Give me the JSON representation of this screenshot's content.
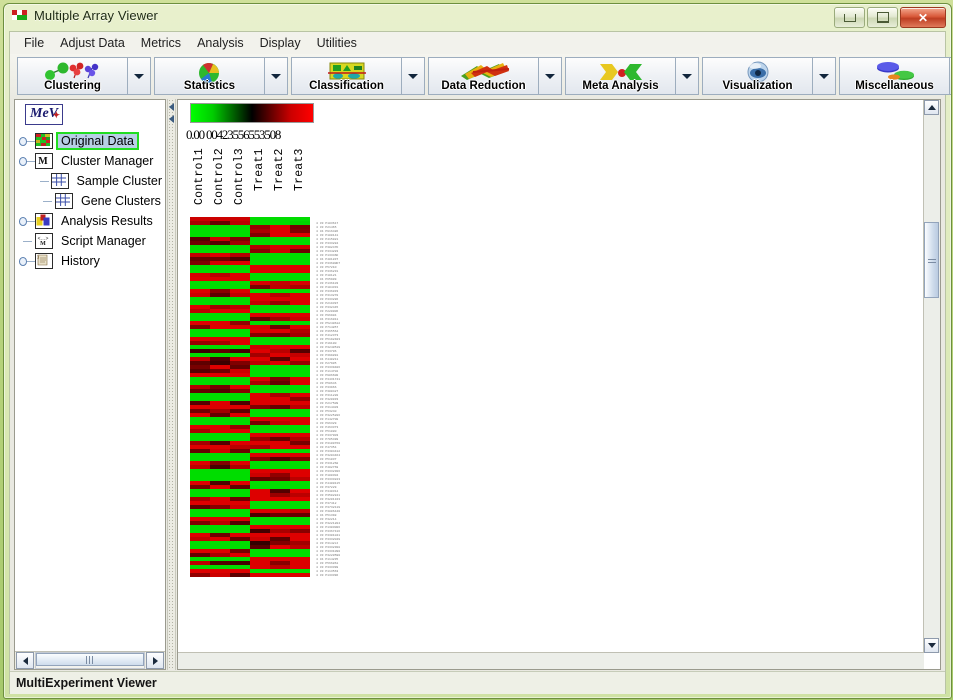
{
  "window": {
    "title": "Multiple Array Viewer",
    "icon": "mev-app-icon",
    "buttons": {
      "minimize": "minimize-icon",
      "maximize": "maximize-icon",
      "close": "✕"
    }
  },
  "menubar": {
    "items": [
      {
        "label": "File"
      },
      {
        "label": "Adjust Data"
      },
      {
        "label": "Metrics"
      },
      {
        "label": "Analysis"
      },
      {
        "label": "Display"
      },
      {
        "label": "Utilities"
      }
    ]
  },
  "toolbar": {
    "groups": [
      {
        "label": "Clustering",
        "icon": "clustering-icon",
        "arrow": "dropdown-arrow"
      },
      {
        "label": "Statistics",
        "icon": "statistics-icon",
        "arrow": "dropdown-arrow"
      },
      {
        "label": "Classification",
        "icon": "classification-icon",
        "arrow": "dropdown-arrow"
      },
      {
        "label": "Data Reduction",
        "icon": "data-reduction-icon",
        "arrow": "dropdown-arrow"
      },
      {
        "label": "Meta Analysis",
        "icon": "meta-analysis-icon",
        "arrow": "dropdown-arrow"
      },
      {
        "label": "Visualization",
        "icon": "visualization-icon",
        "arrow": "dropdown-arrow"
      },
      {
        "label": "Miscellaneous",
        "icon": "miscellaneous-icon",
        "arrow": "dropdown-arrow"
      }
    ]
  },
  "sidebar": {
    "logo": "MeV",
    "nodes": [
      {
        "label": "Original Data",
        "icon": "heatmap-icon",
        "indent": 0,
        "handle": "expand",
        "selected": true
      },
      {
        "label": "Cluster Manager",
        "icon": "cluster-manager-icon",
        "indent": 0,
        "handle": "collapse",
        "selected": false
      },
      {
        "label": "Sample Cluster",
        "icon": "grid-icon",
        "indent": 1,
        "handle": "leaf",
        "selected": false
      },
      {
        "label": "Gene Clusters",
        "icon": "grid-icon",
        "indent": 1,
        "handle": "leaf-last",
        "selected": false
      },
      {
        "label": "Analysis Results",
        "icon": "analysis-results-icon",
        "indent": 0,
        "handle": "expand",
        "selected": false
      },
      {
        "label": "Script Manager",
        "icon": "script-manager-icon",
        "indent": 0,
        "handle": "leaf",
        "selected": false
      },
      {
        "label": "History",
        "icon": "history-icon",
        "indent": 0,
        "handle": "expand",
        "selected": false
      }
    ],
    "hscrollbar": "horizontal-scrollbar"
  },
  "viewer": {
    "scale_gradient": [
      "#00ff00",
      "#000000",
      "#ff0000"
    ],
    "scale_labels": "0.00 00423556553508",
    "columns": [
      "Control1",
      "Control2",
      "Control3",
      "Treat1",
      "Treat2",
      "Treat3"
    ],
    "group_bar": [
      {
        "color": "#cc0000",
        "span": 3
      },
      {
        "color": "#00dd00",
        "span": 3
      }
    ],
    "vscrollbar": "vertical-scrollbar",
    "hscrollbar": "horizontal-scrollbar"
  },
  "statusbar": {
    "text": "MultiExperiment Viewer"
  },
  "chart_data": {
    "type": "heatmap",
    "title": "Original Data",
    "xlabel": "",
    "ylabel": "",
    "columns": [
      "Control1",
      "Control2",
      "Control3",
      "Treat1",
      "Treat2",
      "Treat3"
    ],
    "colormap": {
      "low": "#00ff00",
      "mid": "#000000",
      "high": "#ff0000"
    },
    "value_range": [
      -3.0,
      3.0
    ],
    "row_labels": [
      "4 33 P103617",
      "4 33 P21465",
      "4 34 P916486",
      "4 33 P100141",
      "4 33 P415021",
      "4 33 P333284",
      "4 33 P30247D",
      "4 33 P334283",
      "4 33 P13346D",
      "4 34 P401837",
      "4 33 P33600D7",
      "4 33 P5721D",
      "4 33 P336231",
      "4 33 P10121",
      "4 34 P65909",
      "4 33 P136103",
      "4 33 P104331",
      "4 33 P336033",
      "4 33 P313270",
      "4 33 P333286",
      "4 33 P219397",
      "4 33 P332445",
      "4 33 P220006",
      "4 33 P96904",
      "4 34 P316011",
      "4 33 P5240612",
      "4 33 P714857",
      "4 33 P365564",
      "4 33 P412373",
      "4 33 P5192403",
      "4 33 P19100",
      "4 33 P3240519",
      "4 33 P33706",
      "4 33 P399891",
      "4 34 P440211",
      "4 33 P27905",
      "4 33 P3339406",
      "4 33 P114702",
      "4 33 P906600",
      "4 33 P3431741",
      "4 33 P50646",
      "4 33 P33966",
      "4 33 P300427",
      "4 33 P311220",
      "4 33 P320033",
      "4 33 P217509",
      "4 33 P314403",
      "4 33 P53240",
      "4 33 P3225286",
      "4 33 P142708",
      "4 33 P96329",
      "4 33 P463373",
      "4 33 P51080",
      "4 33 P337003",
      "4 33 P705499",
      "4 33 P3100760",
      "4 33 P47354",
      "4 33 P3304412",
      "4 33 P3204464",
      "4 33 P51037",
      "4 33 P331260",
      "4 33 P402769",
      "4 33 P3332306",
      "4 33 P100304",
      "4 33 P3333223",
      "4 33 P4400115",
      "4 33 P37229",
      "4 33 P340314",
      "4 33 P3502841",
      "4 33 P3201343",
      "4 33 P37412",
      "4 33 P3732119",
      "4 33 P3806440",
      "4 34 P51398",
      "4 33 P32214",
      "4 33 P3221204",
      "4 33 P1303006",
      "4 33 P3367416",
      "4 33 P3301041",
      "4 33 P3332049",
      "4 33 P3142JJ",
      "4 33 P3332308",
      "4 33 P3331090",
      "4 33 P3220590",
      "4 34 P114235",
      "4 33 P566861",
      "4 33 P333399",
      "4 33 P113563",
      "4 33 P133396"
    ],
    "description": "Gene expression heatmap, 6 samples (3 control, 3 treatment), alternating anti-correlated blocks: rows that are green in control columns are red in treatment columns and vice versa.",
    "rows": [
      [
        2.0,
        1.2,
        2.2,
        -2.6,
        -2.6,
        -2.5
      ],
      [
        -2.6,
        -2.6,
        -2.6,
        1.8,
        2.6,
        1.4
      ],
      [
        -2.6,
        -2.6,
        -2.6,
        2.0,
        2.6,
        1.5
      ],
      [
        -2.6,
        -2.6,
        -2.6,
        1.5,
        2.6,
        2.6
      ],
      [
        1.0,
        2.4,
        1.5,
        -2.6,
        -2.6,
        -2.6
      ],
      [
        1.3,
        1.0,
        1.9,
        -2.6,
        -2.6,
        -2.6
      ],
      [
        -2.6,
        -2.6,
        -2.6,
        2.1,
        2.5,
        2.4
      ],
      [
        -2.6,
        -2.6,
        -2.6,
        1.6,
        2.4,
        1.3
      ],
      [
        2.3,
        2.6,
        2.1,
        -2.6,
        -2.6,
        -2.6
      ],
      [
        1.2,
        1.3,
        0.9,
        -2.6,
        -2.6,
        -2.6
      ],
      [
        1.5,
        2.5,
        2.6,
        -2.6,
        -2.6,
        -2.6
      ],
      [
        -2.6,
        -2.6,
        -2.6,
        2.6,
        2.6,
        2.6
      ],
      [
        -2.6,
        -2.6,
        -2.6,
        2.6,
        2.6,
        2.6
      ],
      [
        2.5,
        2.2,
        2.6,
        -2.6,
        -2.6,
        -2.6
      ],
      [
        2.6,
        2.6,
        2.6,
        -2.6,
        -2.6,
        -2.6
      ],
      [
        -2.6,
        -2.6,
        -2.6,
        2.5,
        2.3,
        2.5
      ],
      [
        -2.6,
        -2.6,
        -2.6,
        1.4,
        2.2,
        2.0
      ],
      [
        2.6,
        1.6,
        2.6,
        -2.6,
        -2.6,
        -2.6
      ],
      [
        2.4,
        1.1,
        2.3,
        2.6,
        2.2,
        2.6
      ],
      [
        -2.6,
        -2.6,
        -2.6,
        2.6,
        2.6,
        2.6
      ],
      [
        -2.6,
        -2.6,
        -2.6,
        2.3,
        1.8,
        2.6
      ],
      [
        2.6,
        1.9,
        2.2,
        -2.6,
        -2.6,
        -2.6
      ],
      [
        2.2,
        2.6,
        2.6,
        -2.6,
        -2.6,
        -2.6
      ],
      [
        -2.6,
        -2.6,
        -2.6,
        2.6,
        2.6,
        2.6
      ],
      [
        -2.6,
        -2.6,
        -2.6,
        1.2,
        1.9,
        2.4
      ],
      [
        2.6,
        2.6,
        1.7,
        -2.6,
        -2.6,
        -2.6
      ],
      [
        1.5,
        2.6,
        2.6,
        2.5,
        1.3,
        2.6
      ],
      [
        -2.6,
        -2.6,
        -2.6,
        2.6,
        2.6,
        2.1
      ],
      [
        -2.6,
        -2.6,
        -2.6,
        1.6,
        1.4,
        1.9
      ],
      [
        2.6,
        2.6,
        2.6,
        -2.6,
        -2.6,
        -2.6
      ],
      [
        1.8,
        2.0,
        2.6,
        -2.6,
        -2.6,
        -2.6
      ],
      [
        -2.6,
        -2.6,
        -2.6,
        2.4,
        2.6,
        2.6
      ],
      [
        0.7,
        1.1,
        0.8,
        2.6,
        2.2,
        1.0
      ],
      [
        -2.6,
        -2.6,
        -2.6,
        1.9,
        2.6,
        2.3
      ],
      [
        2.2,
        0.9,
        2.6,
        2.6,
        1.1,
        2.6
      ],
      [
        1.1,
        0.7,
        1.5,
        2.2,
        2.6,
        1.8
      ],
      [
        1.4,
        2.6,
        1.2,
        -2.6,
        -2.6,
        -2.6
      ],
      [
        1.0,
        1.3,
        2.4,
        -2.6,
        -2.6,
        -2.6
      ],
      [
        2.6,
        2.6,
        2.6,
        -2.6,
        -2.6,
        -2.6
      ],
      [
        -2.6,
        -2.6,
        -2.6,
        2.6,
        1.5,
        2.6
      ],
      [
        -2.6,
        -2.6,
        -2.6,
        2.0,
        1.2,
        2.6
      ],
      [
        2.1,
        1.4,
        2.6,
        -2.6,
        -2.6,
        -2.6
      ],
      [
        1.2,
        1.0,
        1.6,
        -2.6,
        -2.6,
        -2.6
      ],
      [
        -2.6,
        -2.6,
        -2.6,
        2.6,
        2.0,
        2.6
      ],
      [
        -2.6,
        -2.6,
        -2.6,
        2.6,
        2.6,
        1.7
      ],
      [
        1.0,
        2.6,
        0.9,
        2.6,
        2.6,
        2.6
      ],
      [
        2.6,
        2.6,
        2.6,
        1.5,
        1.2,
        2.2
      ],
      [
        1.3,
        1.9,
        1.1,
        -2.6,
        -2.6,
        -2.6
      ],
      [
        2.6,
        1.2,
        2.6,
        -2.6,
        -2.6,
        -2.6
      ],
      [
        -2.6,
        -2.6,
        -2.6,
        2.6,
        2.6,
        2.6
      ],
      [
        -2.6,
        -2.6,
        -2.6,
        1.4,
        2.3,
        2.6
      ],
      [
        2.6,
        2.6,
        1.8,
        -2.6,
        -2.6,
        -2.6
      ],
      [
        2.0,
        2.6,
        2.6,
        -2.6,
        -2.6,
        -2.6
      ],
      [
        -2.6,
        -2.6,
        -2.6,
        2.6,
        2.6,
        2.6
      ],
      [
        -2.6,
        -2.6,
        -2.6,
        1.8,
        1.2,
        2.1
      ],
      [
        1.9,
        1.0,
        2.6,
        2.6,
        2.6,
        1.4
      ],
      [
        2.6,
        2.6,
        2.2,
        2.0,
        2.6,
        2.6
      ],
      [
        1.2,
        2.4,
        1.3,
        -2.6,
        -2.6,
        -2.6
      ],
      [
        -2.6,
        -2.6,
        -2.6,
        2.6,
        2.6,
        2.6
      ],
      [
        -2.6,
        -2.6,
        -2.6,
        1.6,
        0.9,
        1.5
      ],
      [
        2.6,
        1.5,
        2.6,
        -2.6,
        -2.6,
        -2.6
      ],
      [
        2.2,
        0.8,
        2.0,
        -2.6,
        -2.6,
        -2.6
      ],
      [
        -2.6,
        -2.6,
        -2.6,
        2.6,
        2.6,
        2.6
      ],
      [
        -2.6,
        -2.6,
        -2.6,
        2.4,
        1.7,
        2.6
      ],
      [
        -2.6,
        -2.6,
        -2.6,
        1.2,
        1.4,
        2.2
      ],
      [
        2.6,
        0.9,
        2.6,
        -2.6,
        -2.6,
        -2.6
      ],
      [
        1.4,
        2.6,
        1.1,
        -2.6,
        -2.6,
        -2.6
      ],
      [
        -2.6,
        -2.6,
        -2.6,
        2.6,
        1.0,
        2.6
      ],
      [
        -2.6,
        -2.6,
        -2.6,
        2.6,
        1.8,
        2.2
      ],
      [
        2.0,
        2.6,
        1.3,
        2.6,
        2.6,
        2.6
      ],
      [
        2.6,
        2.6,
        2.6,
        -2.6,
        -2.6,
        -2.6
      ],
      [
        1.1,
        1.6,
        2.4,
        -2.6,
        -2.6,
        -2.6
      ],
      [
        -2.6,
        -2.6,
        -2.6,
        2.6,
        2.6,
        2.3
      ],
      [
        -2.6,
        -2.6,
        -2.6,
        0.9,
        1.3,
        1.2
      ],
      [
        2.6,
        2.6,
        2.6,
        -2.6,
        -2.6,
        -2.6
      ],
      [
        1.5,
        2.2,
        1.0,
        -2.6,
        -2.6,
        -2.6
      ],
      [
        -2.6,
        -2.6,
        -2.6,
        2.6,
        2.6,
        2.6
      ],
      [
        -2.6,
        -2.6,
        -2.6,
        0.8,
        2.0,
        1.6
      ],
      [
        2.6,
        1.3,
        2.6,
        2.6,
        2.6,
        2.6
      ],
      [
        2.3,
        2.6,
        1.2,
        2.4,
        1.1,
        2.6
      ],
      [
        -2.6,
        -2.6,
        -2.6,
        0.6,
        1.5,
        1.9
      ],
      [
        -2.6,
        -2.6,
        -2.6,
        1.0,
        2.6,
        2.2
      ],
      [
        2.6,
        2.6,
        1.4,
        -2.6,
        -2.6,
        -2.6
      ],
      [
        1.2,
        2.0,
        2.6,
        -2.6,
        -2.6,
        -2.6
      ],
      [
        -2.6,
        -2.6,
        -2.6,
        2.6,
        2.6,
        2.6
      ],
      [
        2.2,
        1.0,
        0.8,
        2.6,
        1.6,
        2.6
      ],
      [
        -2.6,
        -2.6,
        -2.6,
        2.6,
        2.2,
        2.6
      ],
      [
        2.6,
        2.6,
        2.6,
        -2.6,
        -2.6,
        -2.6
      ],
      [
        1.7,
        2.4,
        1.1,
        2.6,
        2.6,
        2.6
      ]
    ]
  }
}
